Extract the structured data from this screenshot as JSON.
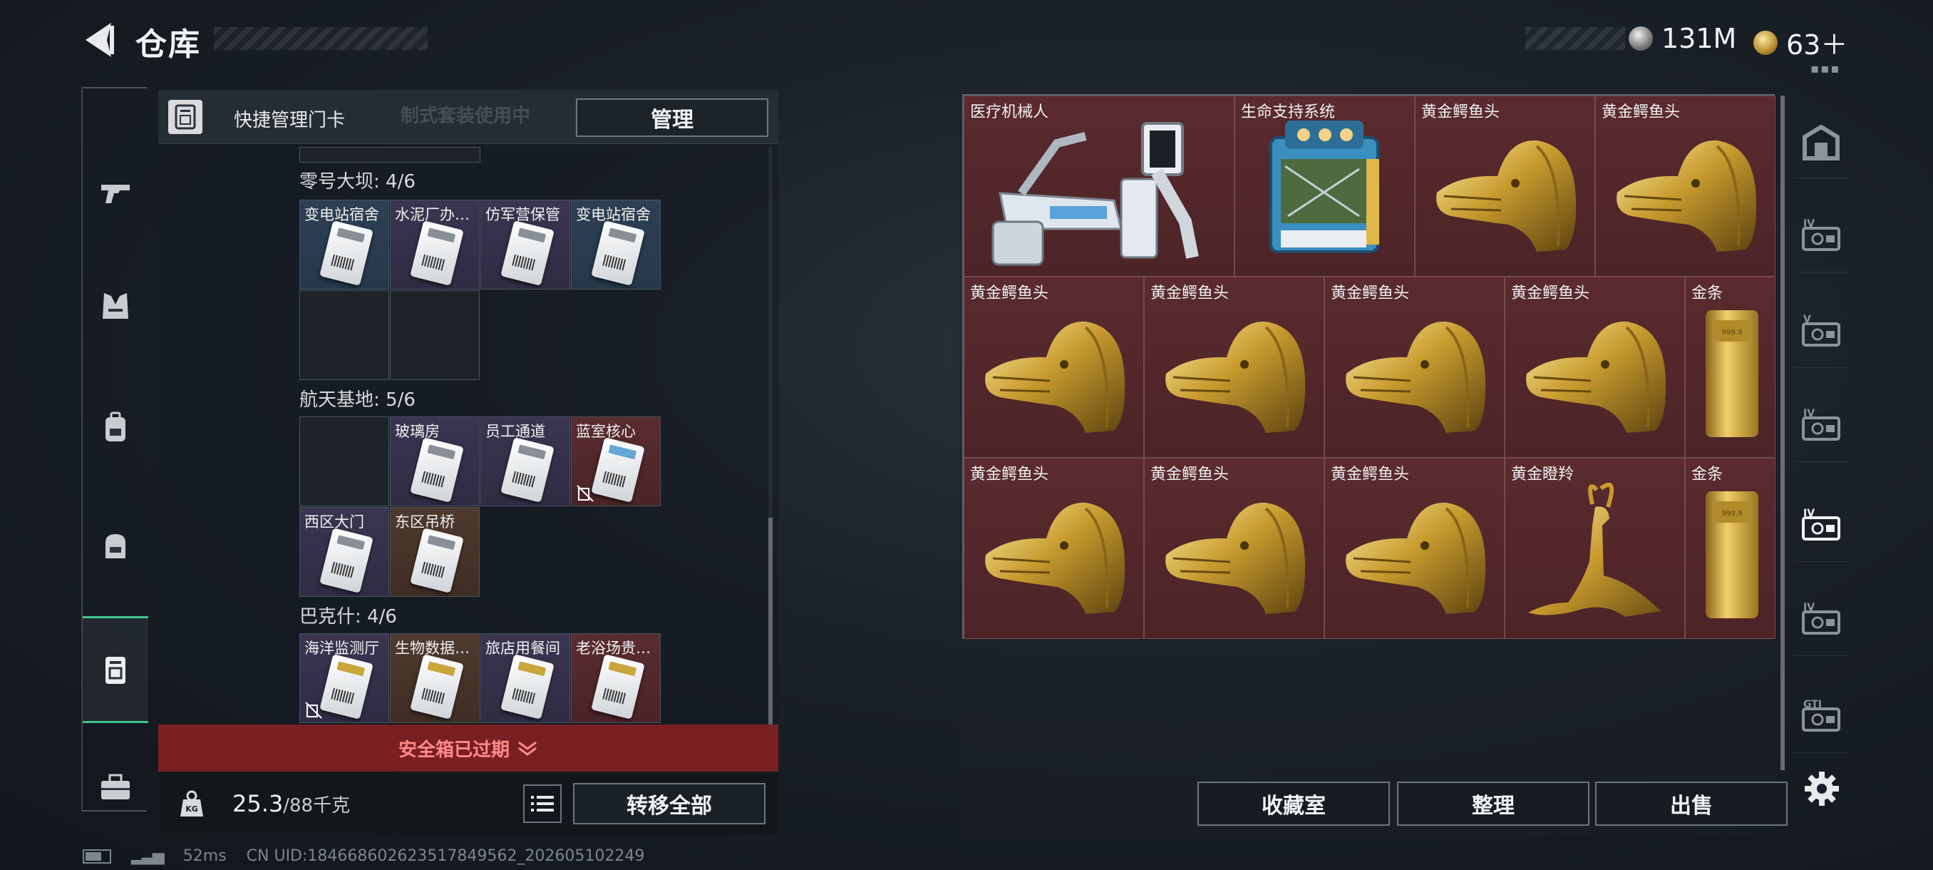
{
  "header": {
    "title": "仓库",
    "back_icon": "chevron-left-icon",
    "currencies": [
      {
        "name": "silver",
        "value": "131M",
        "icon": "silver-coin-icon"
      },
      {
        "name": "gold",
        "value": "63＋",
        "icon": "gold-coin-icon"
      }
    ]
  },
  "left_nav": [
    {
      "id": "weapons",
      "icon": "pistol-icon"
    },
    {
      "id": "armor",
      "icon": "vest-icon"
    },
    {
      "id": "backpack",
      "icon": "backpack-icon"
    },
    {
      "id": "helmet",
      "icon": "bag-icon"
    },
    {
      "id": "keycards",
      "icon": "keycard-icon",
      "active": true
    },
    {
      "id": "toolbox",
      "icon": "toolbox-icon"
    }
  ],
  "keycard_panel": {
    "title": "快捷管理门卡",
    "ghost_text": "制式套装使用中",
    "manage_label": "管理",
    "groups": [
      {
        "name": "零号大坝: 4/6",
        "slots": [
          {
            "label": "变电站宿舍",
            "color": "blue"
          },
          {
            "label": "水泥厂办…",
            "color": "purple"
          },
          {
            "label": "仿军营保管",
            "color": "purple"
          },
          {
            "label": "变电站宿舍",
            "color": "blue"
          },
          {
            "label": "",
            "color": "empty"
          },
          {
            "label": "",
            "color": "empty"
          }
        ]
      },
      {
        "name": "航天基地: 5/6",
        "slots": [
          {
            "label": "",
            "color": "empty"
          },
          {
            "label": "玻璃房",
            "color": "purple"
          },
          {
            "label": "员工通道",
            "color": "purple"
          },
          {
            "label": "蓝室核心",
            "color": "red",
            "broken": true
          },
          {
            "label": "西区大门",
            "color": "purple"
          },
          {
            "label": "东区吊桥",
            "color": "brown"
          }
        ]
      },
      {
        "name": "巴克什: 4/6",
        "slots": [
          {
            "label": "海洋监测厅",
            "color": "purple",
            "broken": true
          },
          {
            "label": "生物数据…",
            "color": "brown"
          },
          {
            "label": "旅店用餐间",
            "color": "purple"
          },
          {
            "label": "老浴场贵…",
            "color": "red"
          }
        ]
      }
    ],
    "expired_label": "安全箱已过期",
    "weight_value": "25.3",
    "weight_capacity": "/88千克",
    "transfer_all_label": "转移全部"
  },
  "inventory": {
    "items": [
      {
        "name": "医疗机械人",
        "art": "robot"
      },
      {
        "name": "生命支持系统",
        "art": "life-support"
      },
      {
        "name": "黄金鳄鱼头",
        "art": "croc"
      },
      {
        "name": "黄金鳄鱼头",
        "art": "croc"
      },
      {
        "name": "黄金鳄鱼头",
        "art": "croc"
      },
      {
        "name": "黄金鳄鱼头",
        "art": "croc"
      },
      {
        "name": "黄金鳄鱼头",
        "art": "croc"
      },
      {
        "name": "黄金鳄鱼头",
        "art": "croc"
      },
      {
        "name": "金条",
        "art": "gold-bar"
      },
      {
        "name": "黄金鳄鱼头",
        "art": "croc"
      },
      {
        "name": "黄金鳄鱼头",
        "art": "croc"
      },
      {
        "name": "黄金鳄鱼头",
        "art": "croc"
      },
      {
        "name": "黄金瞪羚",
        "art": "gazelle"
      },
      {
        "name": "金条",
        "art": "gold-bar"
      }
    ],
    "buttons": {
      "collection": "收藏室",
      "organize": "整理",
      "sell": "出售"
    }
  },
  "right_nav": [
    {
      "id": "home",
      "icon": "home-case-icon",
      "roman": ""
    },
    {
      "id": "case-4a",
      "icon": "case-icon",
      "roman": "IV"
    },
    {
      "id": "case-5",
      "icon": "case-icon",
      "roman": "V"
    },
    {
      "id": "case-4b",
      "icon": "case-icon",
      "roman": "IV"
    },
    {
      "id": "case-4c",
      "icon": "case-icon",
      "roman": "IV",
      "active": true
    },
    {
      "id": "case-4d",
      "icon": "case-icon",
      "roman": "IV"
    },
    {
      "id": "case-gti",
      "icon": "case-icon",
      "roman": "GTI"
    }
  ],
  "status": {
    "ping": "52ms",
    "uid": "CN UID:184668602623517849562_202605102249"
  },
  "colors": {
    "accent": "#3ec58c",
    "expired": "#7a1f22",
    "cell_red": "#5a2a2e"
  }
}
